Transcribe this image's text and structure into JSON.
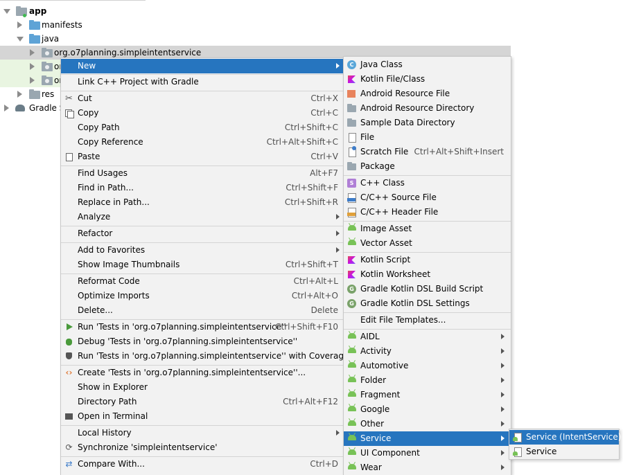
{
  "colors": {
    "selection": "#2675bf",
    "menu_bg": "#f2f2f2",
    "android_green": "#78c257",
    "tree_highlight": "#d5d5d5",
    "tree_green_bg": "#e9f5e1"
  },
  "tree": {
    "app": "app",
    "manifests": "manifests",
    "java": "java",
    "pkg1": "org.o7planning.simpleintentservice",
    "pkg2": "or",
    "pkg3": "or",
    "res": "res",
    "gradle": "Gradle Sc"
  },
  "context_menu": {
    "new": "New",
    "link_cpp": "Link C++ Project with Gradle",
    "cut": "Cut",
    "cut_sc": "Ctrl+X",
    "copy": "Copy",
    "copy_sc": "Ctrl+C",
    "copy_path": "Copy Path",
    "copy_path_sc": "Ctrl+Shift+C",
    "copy_reference": "Copy Reference",
    "copy_reference_sc": "Ctrl+Alt+Shift+C",
    "paste": "Paste",
    "paste_sc": "Ctrl+V",
    "find_usages": "Find Usages",
    "find_usages_sc": "Alt+F7",
    "find_in_path": "Find in Path...",
    "find_in_path_sc": "Ctrl+Shift+F",
    "replace_in_path": "Replace in Path...",
    "replace_in_path_sc": "Ctrl+Shift+R",
    "analyze": "Analyze",
    "refactor": "Refactor",
    "add_favorites": "Add to Favorites",
    "show_thumbnails": "Show Image Thumbnails",
    "show_thumbnails_sc": "Ctrl+Shift+T",
    "reformat": "Reformat Code",
    "reformat_sc": "Ctrl+Alt+L",
    "optimize": "Optimize Imports",
    "optimize_sc": "Ctrl+Alt+O",
    "delete": "Delete...",
    "delete_sc": "Delete",
    "run": "Run 'Tests in 'org.o7planning.simpleintentservice''",
    "run_sc": "Ctrl+Shift+F10",
    "debug": "Debug 'Tests in 'org.o7planning.simpleintentservice''",
    "run_cov": "Run 'Tests in 'org.o7planning.simpleintentservice'' with Coverage",
    "create_tests": "Create 'Tests in 'org.o7planning.simpleintentservice''...",
    "show_explorer": "Show in Explorer",
    "dir_path": "Directory Path",
    "dir_path_sc": "Ctrl+Alt+F12",
    "open_terminal": "Open in Terminal",
    "local_history": "Local History",
    "synchronize": "Synchronize 'simpleintentservice'",
    "compare": "Compare With...",
    "compare_sc": "Ctrl+D"
  },
  "new_menu": {
    "java_class": "Java Class",
    "kotlin_file": "Kotlin File/Class",
    "android_resource_file": "Android Resource File",
    "android_resource_dir": "Android Resource Directory",
    "sample_data_dir": "Sample Data Directory",
    "file": "File",
    "scratch_file": "Scratch File",
    "scratch_file_sc": "Ctrl+Alt+Shift+Insert",
    "package": "Package",
    "cpp_class": "C++ Class",
    "cpp_source": "C/C++ Source File",
    "cpp_header": "C/C++ Header File",
    "image_asset": "Image Asset",
    "vector_asset": "Vector Asset",
    "kotlin_script": "Kotlin Script",
    "kotlin_worksheet": "Kotlin Worksheet",
    "gradle_build_script": "Gradle Kotlin DSL Build Script",
    "gradle_settings": "Gradle Kotlin DSL Settings",
    "edit_templates": "Edit File Templates...",
    "aidl": "AIDL",
    "activity": "Activity",
    "automotive": "Automotive",
    "folder": "Folder",
    "fragment": "Fragment",
    "google": "Google",
    "other": "Other",
    "service": "Service",
    "ui_component": "UI Component",
    "wear": "Wear"
  },
  "service_menu": {
    "intent_service": "Service (IntentService)",
    "service": "Service"
  }
}
